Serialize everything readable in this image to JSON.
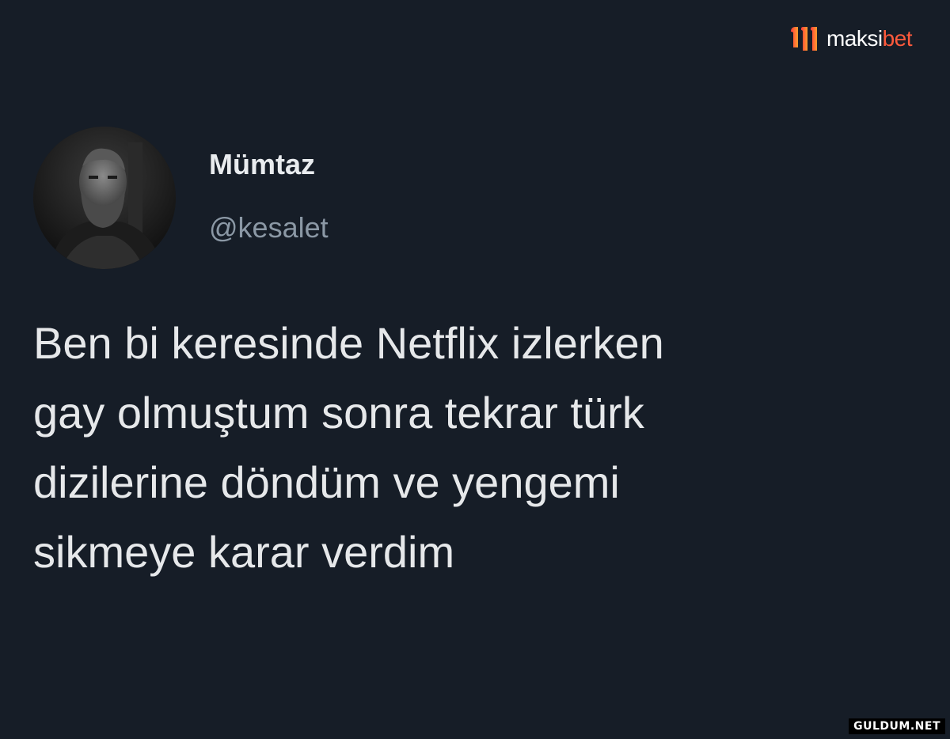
{
  "brand": {
    "name_part1": "maksi",
    "name_part2": "bet",
    "icon": "maksibet-logo-icon",
    "colors": {
      "mark_left": "#ff3b3b",
      "mark_right": "#ff9d2e",
      "accent": "#ff5a3c"
    }
  },
  "tweet": {
    "display_name": "Mümtaz",
    "handle": "@kesalet",
    "avatar_icon": "profile-photo",
    "lines": [
      "Ben bi keresinde Netflix izlerken",
      "gay olmuştum sonra tekrar türk",
      "dizilerine döndüm ve yengemi",
      "sikmeye karar verdim"
    ]
  },
  "watermark": "GULDUM.NET",
  "colors": {
    "background": "#161d27",
    "text_primary": "#e6e8ea",
    "text_secondary": "#8b98a5"
  }
}
